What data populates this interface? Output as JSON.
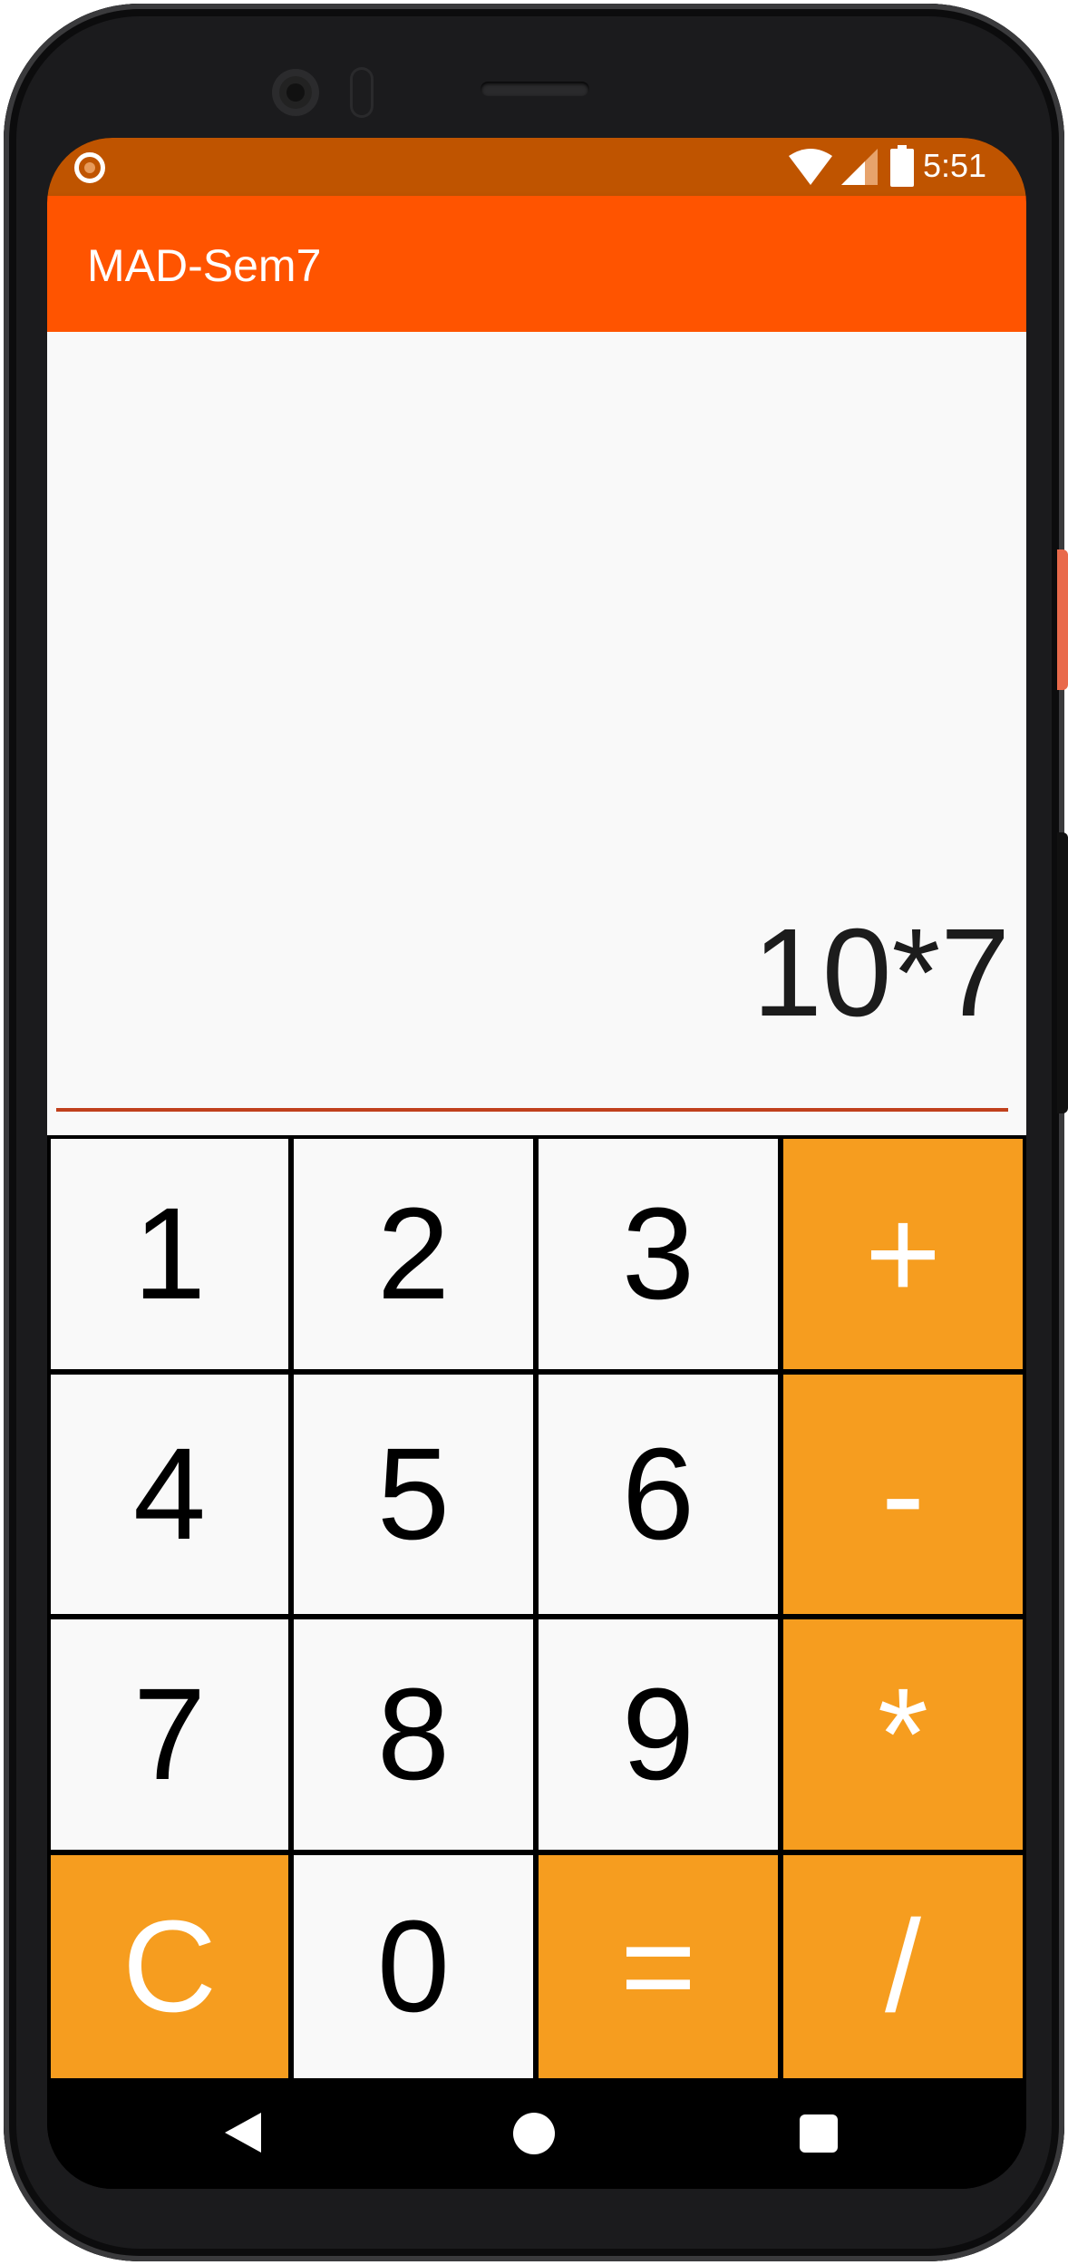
{
  "status": {
    "time": "5:51"
  },
  "app": {
    "title": "MAD-Sem7"
  },
  "display": {
    "expression": "10*7"
  },
  "keys": [
    {
      "label": "1"
    },
    {
      "label": "2"
    },
    {
      "label": "3"
    },
    {
      "label": "+"
    },
    {
      "label": "4"
    },
    {
      "label": "5"
    },
    {
      "label": "6"
    },
    {
      "label": "-"
    },
    {
      "label": "7"
    },
    {
      "label": "8"
    },
    {
      "label": "9"
    },
    {
      "label": "*"
    },
    {
      "label": "C"
    },
    {
      "label": "0"
    },
    {
      "label": "="
    },
    {
      "label": "/"
    }
  ],
  "colors": {
    "status_bar": "#bf5400",
    "app_bar": "#ff5400",
    "operator_key": "#f69d1f",
    "number_key": "#f9f9f9",
    "underline": "#c0401c"
  },
  "nav": {
    "icons": [
      "back-icon",
      "home-icon",
      "recents-icon"
    ]
  }
}
